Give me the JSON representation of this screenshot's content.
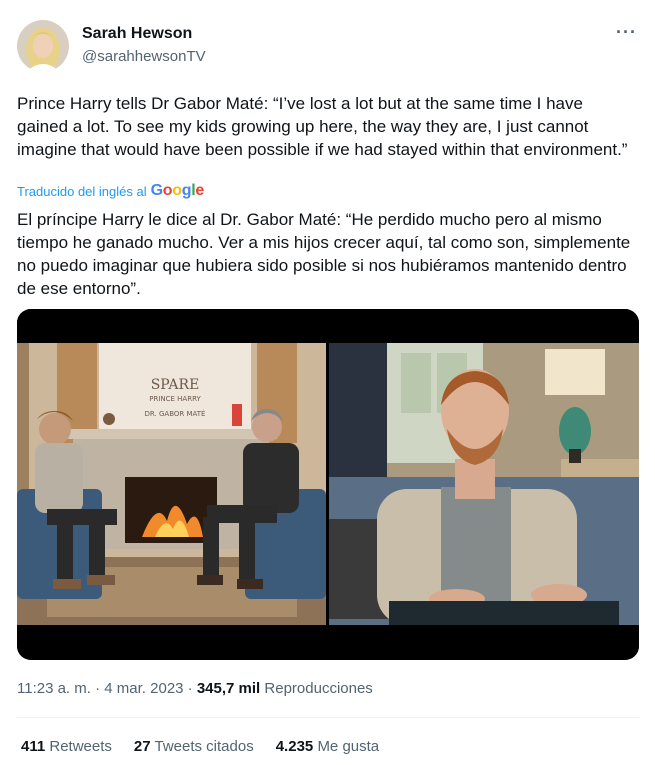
{
  "author": {
    "name": "Sarah Hewson",
    "handle": "@sarahhewsonTV"
  },
  "more_label": "···",
  "tweet_text": "Prince Harry tells Dr Gabor Maté: “I’ve lost a lot but at the same time I have gained a lot. To see my kids growing up here, the way they are, I just cannot imagine that would have been possible if we had stayed within that environment.”",
  "translated_label": "Traducido del inglés al",
  "google_letters": [
    "G",
    "o",
    "o",
    "g",
    "l",
    "e"
  ],
  "translation_text": "El príncipe Harry le dice al Dr. Gabor Maté: “He perdido mucho pero al mismo tiempo he ganado mucho. Ver a mis hijos crecer aquí, tal como son, simplemente no puedo imaginar que hubiera sido posible si nos hubiéramos mantenido dentro de ese entorno”.",
  "media": {
    "left_image": {
      "banner_title": "SPARE",
      "banner_sub": "PRINCE HARRY",
      "banner_author": "DR. GABOR MATÉ"
    }
  },
  "meta": {
    "time": "11:23 a. m.",
    "date": "4 mar. 2023",
    "views": "345,7 mil",
    "views_label": "Reproducciones"
  },
  "stats": {
    "retweets_count": "411",
    "retweets_label": "Retweets",
    "quotes_count": "27",
    "quotes_label": "Tweets citados",
    "likes_count": "4.235",
    "likes_label": "Me gusta"
  }
}
